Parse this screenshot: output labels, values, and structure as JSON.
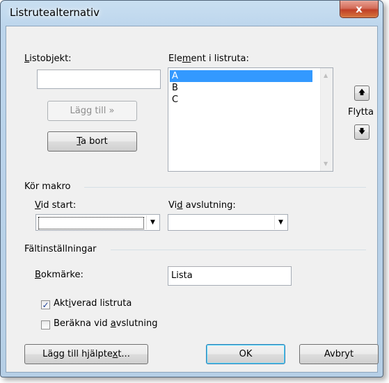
{
  "window": {
    "title": "Listrutealternativ",
    "close_label": "x"
  },
  "listobjekt": {
    "label_u": "L",
    "label_rest": "istobjekt:",
    "value": ""
  },
  "add_button": {
    "label": "Lägg till",
    "suffix": "»"
  },
  "remove_button": {
    "label_u": "T",
    "label_rest": "a bort"
  },
  "list": {
    "label_pre": "Ele",
    "label_u": "m",
    "label_rest": "ent i listruta:",
    "items": [
      {
        "label": "A",
        "selected": true
      },
      {
        "label": "B",
        "selected": false
      },
      {
        "label": "C",
        "selected": false
      }
    ]
  },
  "move": {
    "label": "Flytta",
    "up_icon": "up-arrow",
    "down_icon": "down-arrow"
  },
  "macro": {
    "group_label": "Kör makro",
    "on_start": {
      "label_u": "V",
      "label_rest": "id start:",
      "value": ""
    },
    "on_exit": {
      "label_pre": "Vi",
      "label_u": "d",
      "label_rest": " avslutning:",
      "value": ""
    }
  },
  "field_settings": {
    "group_label": "Fältinställningar",
    "bookmark": {
      "label_u": "B",
      "label_rest": "okmärke:",
      "value": "Lista"
    },
    "enabled": {
      "label_pre": "Akt",
      "label_u": "i",
      "label_rest": "verad listruta",
      "checked": true
    },
    "calc_on_exit": {
      "label_pre": "Beräkna vid ",
      "label_u": "a",
      "label_rest": "vslutning",
      "checked": false
    }
  },
  "buttons": {
    "help_pre": "Lägg till hjälpte",
    "help_u": "x",
    "help_rest": "t...",
    "ok": "OK",
    "cancel": "Avbryt"
  }
}
